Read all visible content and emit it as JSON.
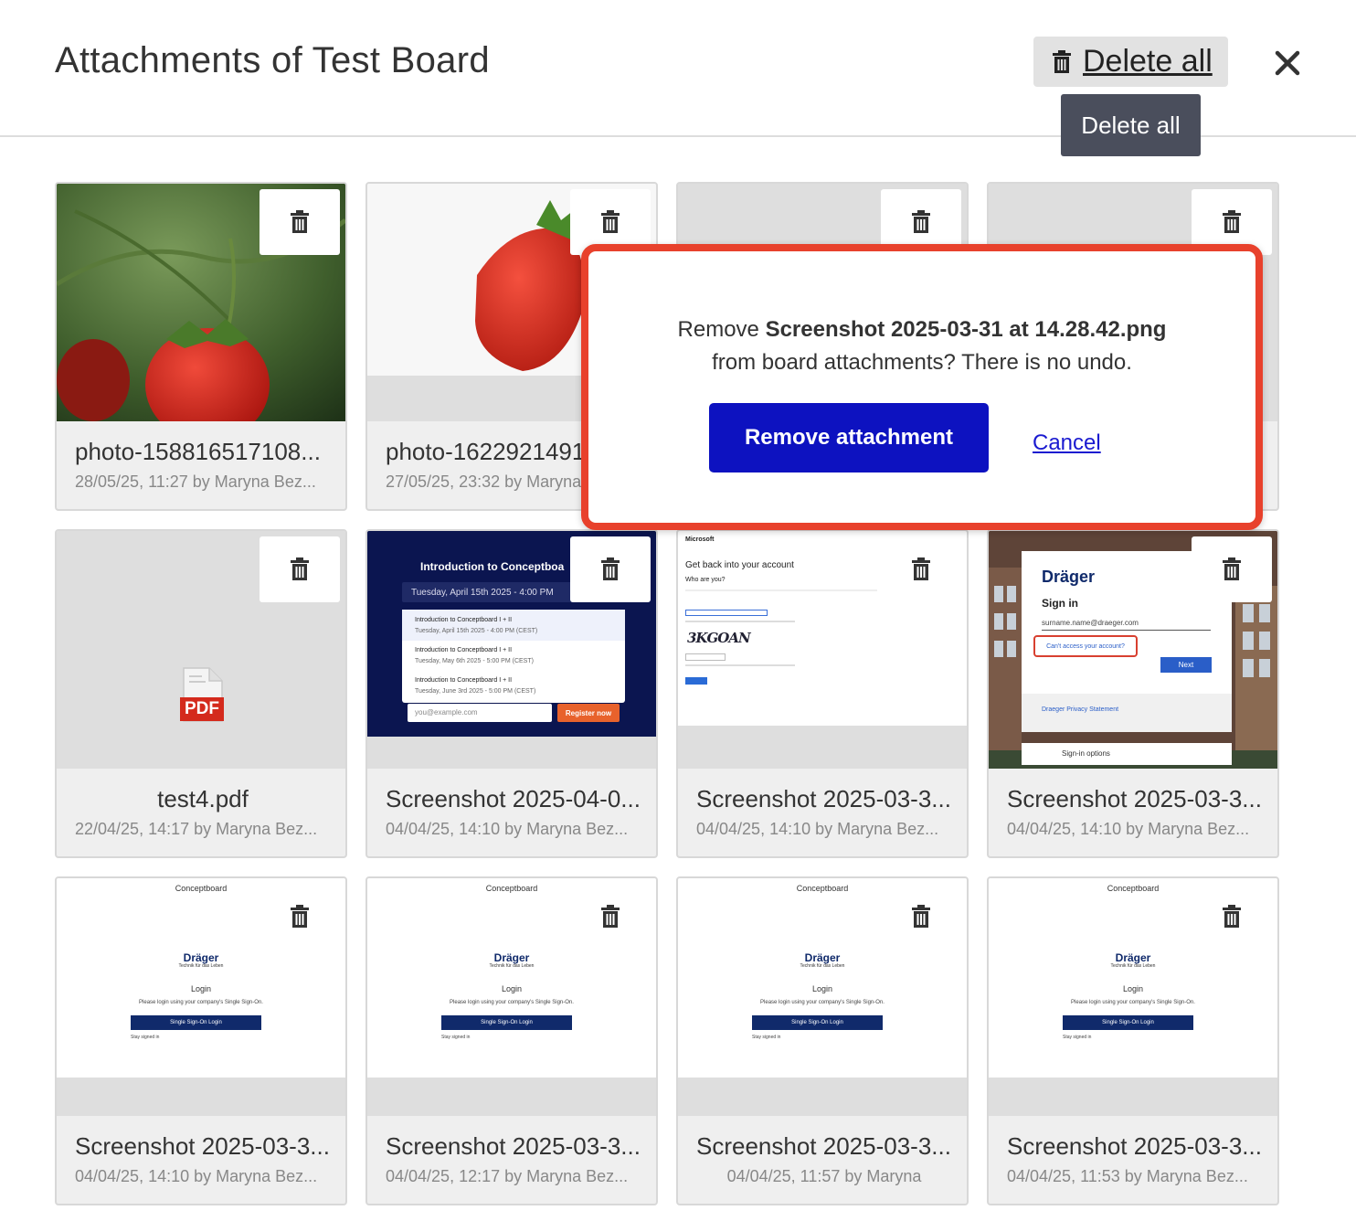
{
  "header": {
    "title": "Attachments of Test Board",
    "delete_all_label": "Delete all",
    "tooltip": "Delete all"
  },
  "dialog": {
    "prefix": "Remove ",
    "filename": "Screenshot 2025-03-31 at 14.28.42.png",
    "suffix": "from board attachments? There is no undo.",
    "confirm_label": "Remove attachment",
    "cancel_label": "Cancel"
  },
  "cards": [
    {
      "name": "photo-158816517108...",
      "meta": "28/05/25, 11:27 by Maryna Bez..."
    },
    {
      "name": "photo-1622921491",
      "meta": "27/05/25, 23:32 by Maryna"
    },
    {
      "name": "",
      "meta": ""
    },
    {
      "name": "",
      "meta": ""
    },
    {
      "name": "test4.pdf",
      "meta": "22/04/25, 14:17 by Maryna Bez...",
      "icon_label": "PDF"
    },
    {
      "name": "Screenshot 2025-04-0...",
      "meta": "04/04/25, 14:10 by Maryna Bez..."
    },
    {
      "name": "Screenshot 2025-03-3...",
      "meta": "04/04/25, 14:10 by Maryna Bez..."
    },
    {
      "name": "Screenshot 2025-03-3...",
      "meta": "04/04/25, 14:10 by Maryna Bez..."
    },
    {
      "name": "Screenshot 2025-03-3...",
      "meta": "04/04/25, 14:10 by Maryna Bez..."
    },
    {
      "name": "Screenshot 2025-03-3...",
      "meta": "04/04/25, 12:17 by Maryna Bez..."
    },
    {
      "name": "Screenshot 2025-03-3...",
      "meta": "04/04/25, 11:57 by Maryna"
    },
    {
      "name": "Screenshot 2025-03-3...",
      "meta": "04/04/25, 11:53 by Maryna Bez..."
    }
  ],
  "thumb_webinar": {
    "title": "Introduction to Conceptboa",
    "date": "Tuesday, April 15th 2025 - 4:00 PM",
    "options": [
      {
        "name": "Introduction to Conceptboard I + II",
        "time": "Tuesday, April 15th 2025 - 4:00 PM (CEST)"
      },
      {
        "name": "Introduction to Conceptboard I + II",
        "time": "Tuesday, May 6th 2025 - 5:00 PM (CEST)"
      },
      {
        "name": "Introduction to Conceptboard I + II",
        "time": "Tuesday, June 3rd 2025 - 5:00 PM (CEST)"
      }
    ],
    "email_placeholder": "you@example.com",
    "register": "Register now"
  },
  "thumb_microsoft": {
    "brand": "Microsoft",
    "heading": "Get back into your account",
    "sub": "Who are you?",
    "captcha": "3KGOAN"
  },
  "thumb_drager_signin": {
    "logo": "Dräger",
    "heading": "Sign in",
    "email": "surname.name@draeger.com",
    "cant_access": "Can't access your account?",
    "next": "Next",
    "privacy": "Draeger Privacy Statement",
    "options": "Sign-in options"
  },
  "thumb_login": {
    "header": "Conceptboard",
    "logo": "Dräger",
    "tagline": "Technik für das Leben",
    "login": "Login",
    "instruction": "Please login using your company's Single Sign-On.",
    "sso": "Single Sign-On Login",
    "stay": "Stay signed in"
  },
  "colors": {
    "accent_button": "#0d12c0",
    "dialog_border": "#e8412c",
    "tooltip_bg": "#4a4e5c"
  }
}
